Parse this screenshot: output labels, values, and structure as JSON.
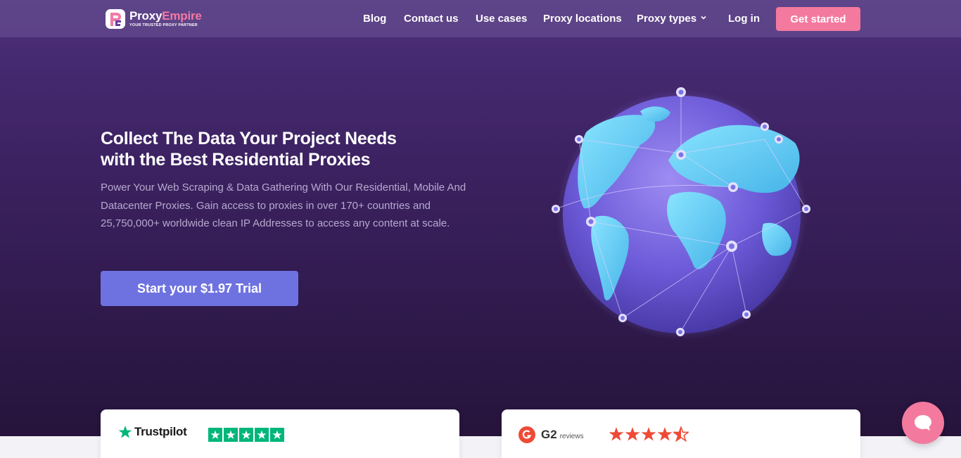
{
  "brand": {
    "name_part1": "Proxy",
    "name_part2": "Empire",
    "tagline": "YOUR TRUSTED PROXY PARTNER"
  },
  "nav": {
    "blog": "Blog",
    "contact": "Contact us",
    "use_cases": "Use cases",
    "proxy_locations": "Proxy locations",
    "proxy_types": "Proxy types",
    "login": "Log in",
    "get_started": "Get started"
  },
  "hero": {
    "headline_line1": "Collect The Data Your Project Needs",
    "headline_line2": "with the Best Residential Proxies",
    "subtext": "Power Your Web Scraping & Data Gathering With Our Residential, Mobile And Datacenter Proxies. Gain access to proxies in over 170+ countries and 25,750,000+ worldwide clean IP Addresses to access any content at scale.",
    "cta": "Start your $1.97 Trial"
  },
  "reviews": {
    "trustpilot": {
      "name": "Trustpilot",
      "stars": 5
    },
    "g2": {
      "name": "G2",
      "suffix": "reviews",
      "stars": 4.5
    }
  },
  "colors": {
    "accent_pink": "#f4799f",
    "cta_purple": "#6e72e0",
    "trustpilot_green": "#00b67a",
    "g2_red": "#ef4a36"
  },
  "icons": {
    "chat": "chat-bubble-icon",
    "dropdown": "chevron-down-icon"
  }
}
